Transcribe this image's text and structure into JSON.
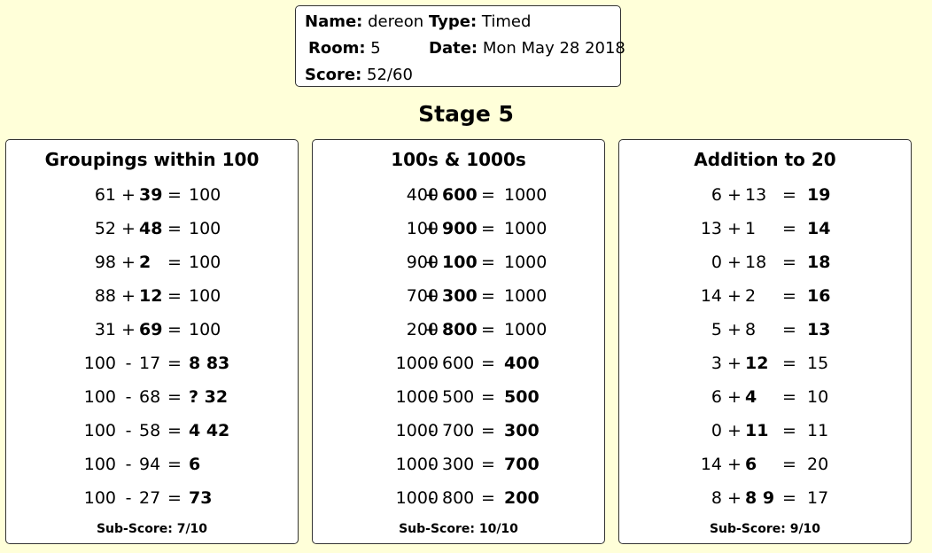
{
  "header": {
    "name_label": "Name:",
    "name_value": "dereon",
    "type_label": "Type:",
    "type_value": "Timed",
    "room_label": "Room:",
    "room_value": "5",
    "date_label": "Date:",
    "date_value": "Mon May 28 2018",
    "score_label": "Score:",
    "score_value": "52/60"
  },
  "stage_title": "Stage 5",
  "panels": [
    {
      "title": "Groupings within 100",
      "sub_score": "Sub-Score: 7/10",
      "rows": [
        {
          "a": "61",
          "op": "+",
          "b": "39",
          "eq": "=",
          "c": "100",
          "bold": "b"
        },
        {
          "a": "52",
          "op": "+",
          "b": "48",
          "eq": "=",
          "c": "100",
          "bold": "b"
        },
        {
          "a": "98",
          "op": "+",
          "b": "2",
          "eq": "=",
          "c": "100",
          "bold": "b"
        },
        {
          "a": "88",
          "op": "+",
          "b": "12",
          "eq": "=",
          "c": "100",
          "bold": "b"
        },
        {
          "a": "31",
          "op": "+",
          "b": "69",
          "eq": "=",
          "c": "100",
          "bold": "b"
        },
        {
          "a": "100",
          "op": "-",
          "b": "17",
          "eq": "=",
          "c": "8 83",
          "bold": "c"
        },
        {
          "a": "100",
          "op": "-",
          "b": "68",
          "eq": "=",
          "c": "? 32",
          "bold": "c"
        },
        {
          "a": "100",
          "op": "-",
          "b": "58",
          "eq": "=",
          "c": "4 42",
          "bold": "c"
        },
        {
          "a": "100",
          "op": "-",
          "b": "94",
          "eq": "=",
          "c": "6",
          "bold": "c"
        },
        {
          "a": "100",
          "op": "-",
          "b": "27",
          "eq": "=",
          "c": "73",
          "bold": "c"
        }
      ]
    },
    {
      "title": "100s & 1000s",
      "sub_score": "Sub-Score: 10/10",
      "rows": [
        {
          "a": "400",
          "op": "+",
          "b": "600",
          "eq": "=",
          "c": "1000",
          "bold": "b"
        },
        {
          "a": "100",
          "op": "+",
          "b": "900",
          "eq": "=",
          "c": "1000",
          "bold": "b"
        },
        {
          "a": "900",
          "op": "+",
          "b": "100",
          "eq": "=",
          "c": "1000",
          "bold": "b"
        },
        {
          "a": "700",
          "op": "+",
          "b": "300",
          "eq": "=",
          "c": "1000",
          "bold": "b"
        },
        {
          "a": "200",
          "op": "+",
          "b": "800",
          "eq": "=",
          "c": "1000",
          "bold": "b"
        },
        {
          "a": "1000",
          "op": "-",
          "b": "600",
          "eq": "=",
          "c": "400",
          "bold": "c"
        },
        {
          "a": "1000",
          "op": "-",
          "b": "500",
          "eq": "=",
          "c": "500",
          "bold": "c"
        },
        {
          "a": "1000",
          "op": "-",
          "b": "700",
          "eq": "=",
          "c": "300",
          "bold": "c"
        },
        {
          "a": "1000",
          "op": "-",
          "b": "300",
          "eq": "=",
          "c": "700",
          "bold": "c"
        },
        {
          "a": "1000",
          "op": "-",
          "b": "800",
          "eq": "=",
          "c": "200",
          "bold": "c"
        }
      ]
    },
    {
      "title": "Addition to 20",
      "sub_score": "Sub-Score: 9/10",
      "rows": [
        {
          "a": "6",
          "op": "+",
          "b": "13",
          "eq": "=",
          "c": "19",
          "bold": "c"
        },
        {
          "a": "13",
          "op": "+",
          "b": "1",
          "eq": "=",
          "c": "14",
          "bold": "c"
        },
        {
          "a": "0",
          "op": "+",
          "b": "18",
          "eq": "=",
          "c": "18",
          "bold": "c"
        },
        {
          "a": "14",
          "op": "+",
          "b": "2",
          "eq": "=",
          "c": "16",
          "bold": "c"
        },
        {
          "a": "5",
          "op": "+",
          "b": "8",
          "eq": "=",
          "c": "13",
          "bold": "c"
        },
        {
          "a": "3",
          "op": "+",
          "b": "12",
          "eq": "=",
          "c": "15",
          "bold": "b"
        },
        {
          "a": "6",
          "op": "+",
          "b": "4",
          "eq": "=",
          "c": "10",
          "bold": "b"
        },
        {
          "a": "0",
          "op": "+",
          "b": "11",
          "eq": "=",
          "c": "11",
          "bold": "b"
        },
        {
          "a": "14",
          "op": "+",
          "b": "6",
          "eq": "=",
          "c": "20",
          "bold": "b"
        },
        {
          "a": "8",
          "op": "+",
          "b": "8 9",
          "eq": "=",
          "c": "17",
          "bold": "b"
        }
      ]
    }
  ]
}
